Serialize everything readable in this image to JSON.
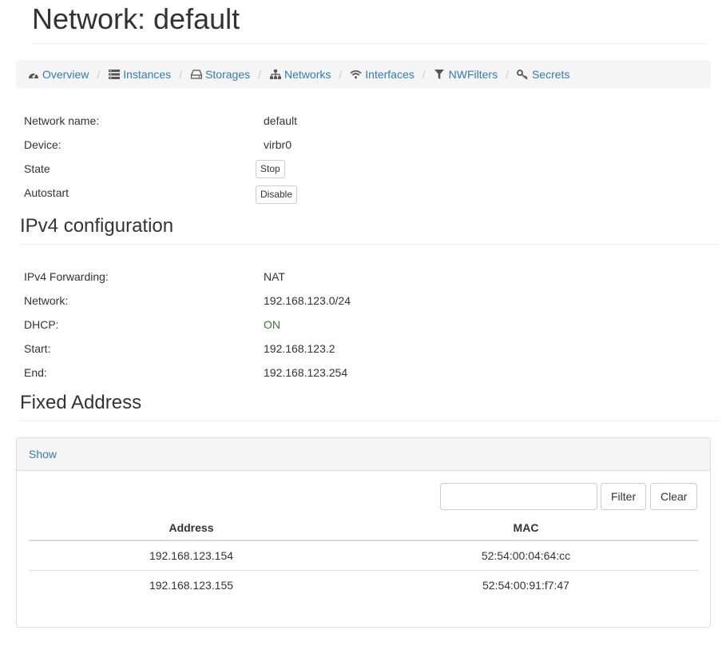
{
  "page_title": "Network: default",
  "breadcrumb": [
    {
      "label": "Overview",
      "icon": "dashboard-icon"
    },
    {
      "label": "Instances",
      "icon": "server-icon"
    },
    {
      "label": "Storages",
      "icon": "hdd-icon"
    },
    {
      "label": "Networks",
      "icon": "sitemap-icon"
    },
    {
      "label": "Interfaces",
      "icon": "wifi-icon"
    },
    {
      "label": "NWFilters",
      "icon": "filter-icon"
    },
    {
      "label": "Secrets",
      "icon": "key-icon"
    }
  ],
  "breadcrumb_separator": "/",
  "info": {
    "network_name": {
      "label": "Network name:",
      "value": "default"
    },
    "device": {
      "label": "Device:",
      "value": "virbr0"
    },
    "state": {
      "label": "State",
      "button": "Stop"
    },
    "autostart": {
      "label": "Autostart",
      "button": "Disable"
    }
  },
  "ipv4": {
    "heading": "IPv4 configuration",
    "forwarding": {
      "label": "IPv4 Forwarding:",
      "value": "NAT"
    },
    "network": {
      "label": "Network:",
      "value": "192.168.123.0/24"
    },
    "dhcp": {
      "label": "DHCP:",
      "value": "ON",
      "value_color": "#3c763d"
    },
    "start": {
      "label": "Start:",
      "value": "192.168.123.2"
    },
    "end": {
      "label": "End:",
      "value": "192.168.123.254"
    }
  },
  "fixed": {
    "heading": "Fixed Address",
    "toggle_label": "Show",
    "filter_input_value": "",
    "filter_button": "Filter",
    "clear_button": "Clear",
    "columns": [
      "Address",
      "MAC"
    ],
    "rows": [
      [
        "192.168.123.154",
        "52:54:00:04:64:cc"
      ],
      [
        "192.168.123.155",
        "52:54:00:91:f7:47"
      ]
    ]
  },
  "colors": {
    "link": "#337ab7",
    "text": "#333333",
    "success": "#3c763d"
  }
}
